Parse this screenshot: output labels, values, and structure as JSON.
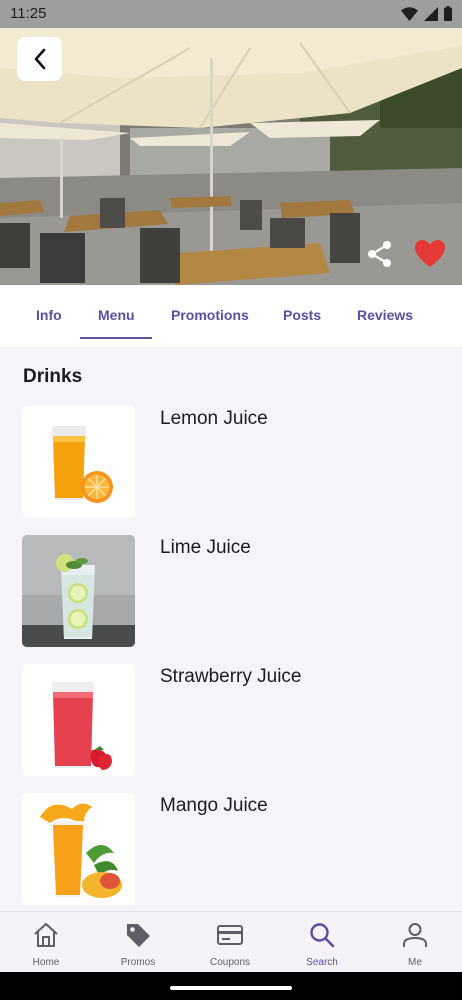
{
  "status_bar": {
    "time": "11:25",
    "icons": [
      "wifi-icon",
      "signal-icon",
      "battery-icon"
    ]
  },
  "hero": {
    "image": "restaurant-terrace-photo",
    "back_icon": "chevron-left-icon",
    "share_icon": "share-icon",
    "favorite_icon": "heart-icon",
    "favorite_color": "#e53935"
  },
  "tabs": {
    "items": [
      {
        "label": "Info"
      },
      {
        "label": "Menu",
        "active": true
      },
      {
        "label": "Promotions"
      },
      {
        "label": "Posts"
      },
      {
        "label": "Reviews"
      }
    ],
    "accent_color": "#5a4f9e"
  },
  "menu": {
    "section_title": "Drinks",
    "items": [
      {
        "name": "Lemon Juice",
        "image": "orange-juice-glass"
      },
      {
        "name": "Lime Juice",
        "image": "lime-soda-glass"
      },
      {
        "name": "Strawberry Juice",
        "image": "red-juice-glass"
      },
      {
        "name": "Mango Juice",
        "image": "mango-juice-splash"
      }
    ]
  },
  "bottom_nav": {
    "items": [
      {
        "label": "Home",
        "icon": "home-icon"
      },
      {
        "label": "Promos",
        "icon": "tag-icon"
      },
      {
        "label": "Coupons",
        "icon": "card-icon"
      },
      {
        "label": "Search",
        "icon": "search-icon",
        "active": true
      },
      {
        "label": "Me",
        "icon": "user-icon"
      }
    ]
  }
}
